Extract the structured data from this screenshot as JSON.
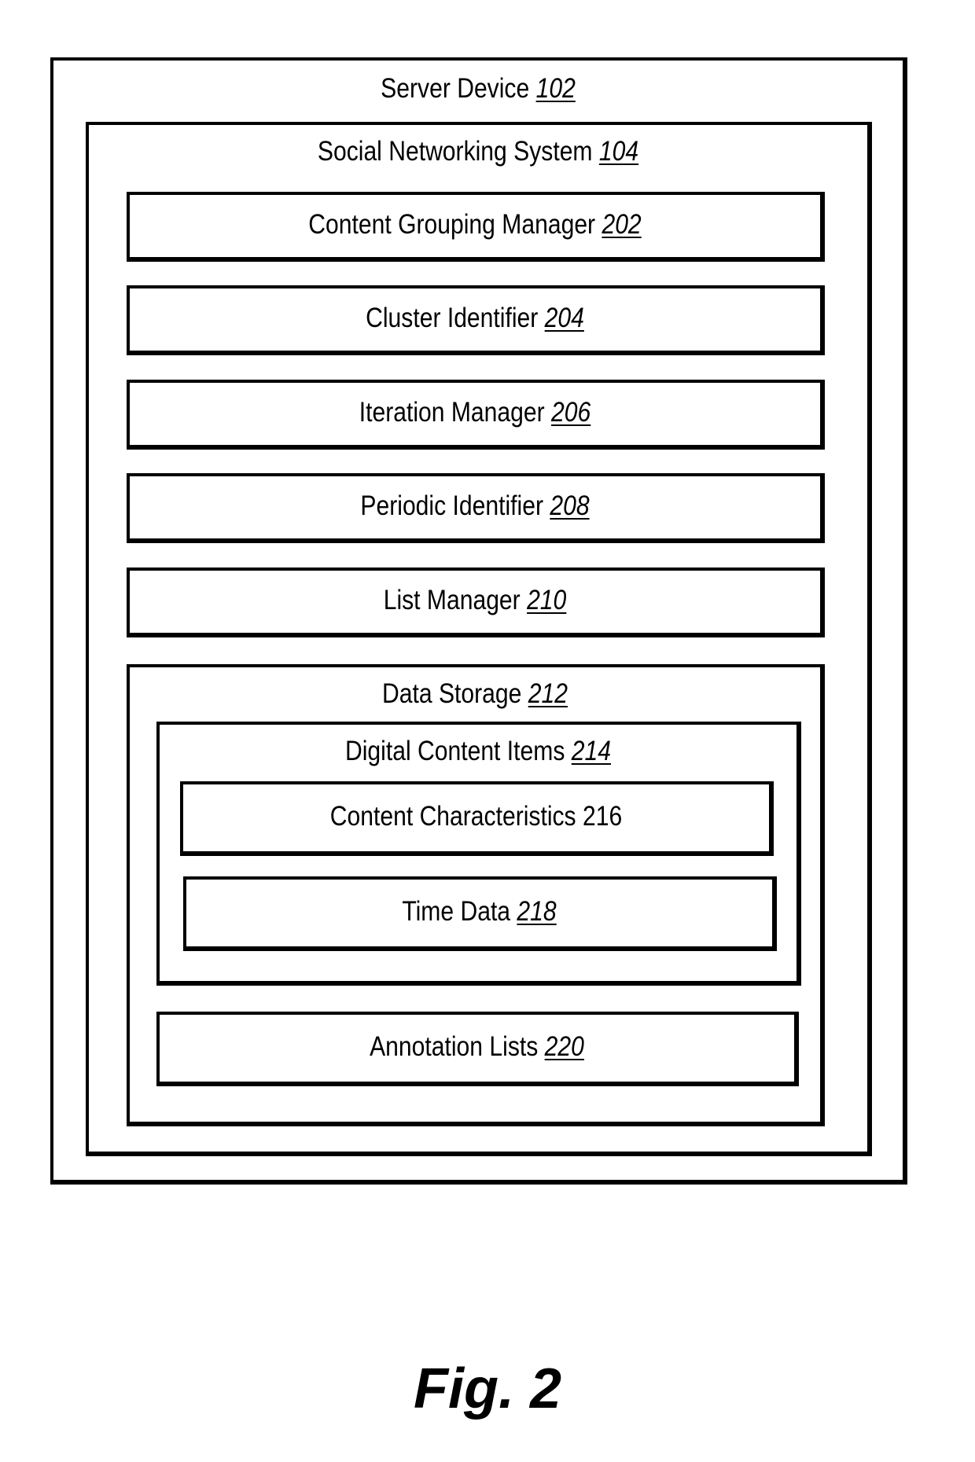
{
  "figure_caption": "Fig. 2",
  "server_device": {
    "name": "Server Device",
    "ref": "102",
    "social_networking_system": {
      "name": "Social Networking System",
      "ref": "104",
      "components": [
        {
          "name": "Content Grouping Manager",
          "ref": "202"
        },
        {
          "name": "Cluster Identifier",
          "ref": "204"
        },
        {
          "name": "Iteration Manager",
          "ref": "206"
        },
        {
          "name": "Periodic Identifier",
          "ref": "208"
        },
        {
          "name": "List Manager",
          "ref": "210"
        }
      ],
      "data_storage": {
        "name": "Data Storage",
        "ref": "212",
        "digital_content_items": {
          "name": "Digital Content Items",
          "ref": "214",
          "content_characteristics": {
            "name": "Content Characteristics",
            "ref": "216"
          },
          "time_data": {
            "name": "Time Data",
            "ref": "218"
          }
        },
        "annotation_lists": {
          "name": "Annotation Lists",
          "ref": "220"
        }
      }
    }
  }
}
